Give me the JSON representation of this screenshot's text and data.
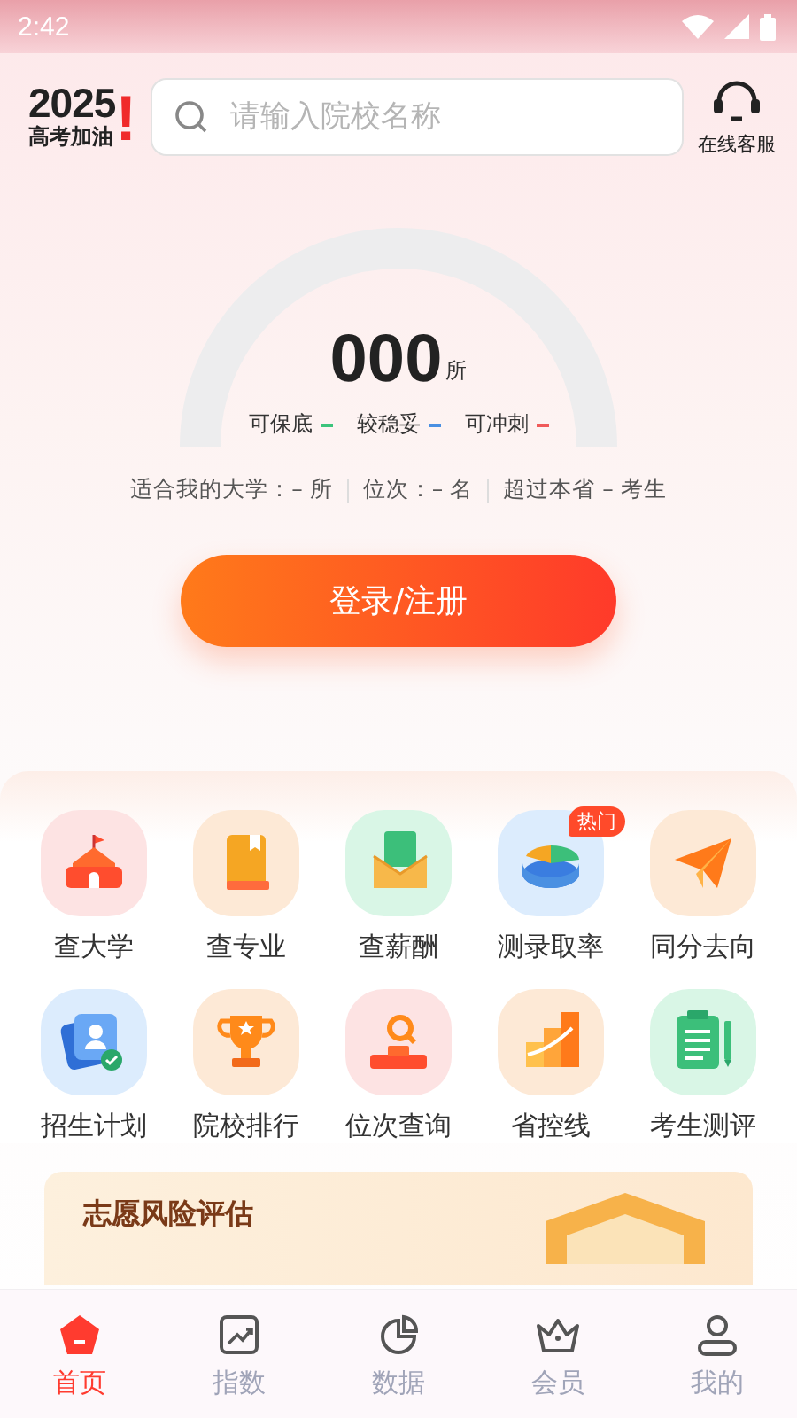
{
  "status_bar": {
    "time": "2:42"
  },
  "header": {
    "logo": {
      "year": "2025",
      "mark": "!",
      "slogan": "高考加油"
    },
    "search": {
      "placeholder": "请输入院校名称"
    },
    "service": {
      "label": "在线客服"
    }
  },
  "gauge": {
    "count": "000",
    "unit": "所",
    "legend": [
      {
        "label": "可保底",
        "color": "#3cc47c"
      },
      {
        "label": "较稳妥",
        "color": "#4a90e2"
      },
      {
        "label": "可冲刺",
        "color": "#f05a5a"
      }
    ]
  },
  "stats": [
    "适合我的大学：– 所",
    "位次：– 名",
    "超过本省 – 考生"
  ],
  "login_button": "登录/注册",
  "tools": [
    {
      "label": "查大学",
      "kind": "university"
    },
    {
      "label": "查专业",
      "kind": "major"
    },
    {
      "label": "查薪酬",
      "kind": "salary"
    },
    {
      "label": "测录取率",
      "kind": "admission",
      "badge": "热门"
    },
    {
      "label": "同分去向",
      "kind": "same-score"
    },
    {
      "label": "招生计划",
      "kind": "plan"
    },
    {
      "label": "院校排行",
      "kind": "ranking"
    },
    {
      "label": "位次查询",
      "kind": "position"
    },
    {
      "label": "省控线",
      "kind": "control-line"
    },
    {
      "label": "考生测评",
      "kind": "assessment"
    }
  ],
  "banner": {
    "title": "志愿风险评估"
  },
  "tabs": [
    {
      "label": "首页",
      "kind": "home",
      "selected": true
    },
    {
      "label": "指数",
      "kind": "index",
      "selected": false
    },
    {
      "label": "数据",
      "kind": "data",
      "selected": false
    },
    {
      "label": "会员",
      "kind": "member",
      "selected": false
    },
    {
      "label": "我的",
      "kind": "mine",
      "selected": false
    }
  ]
}
